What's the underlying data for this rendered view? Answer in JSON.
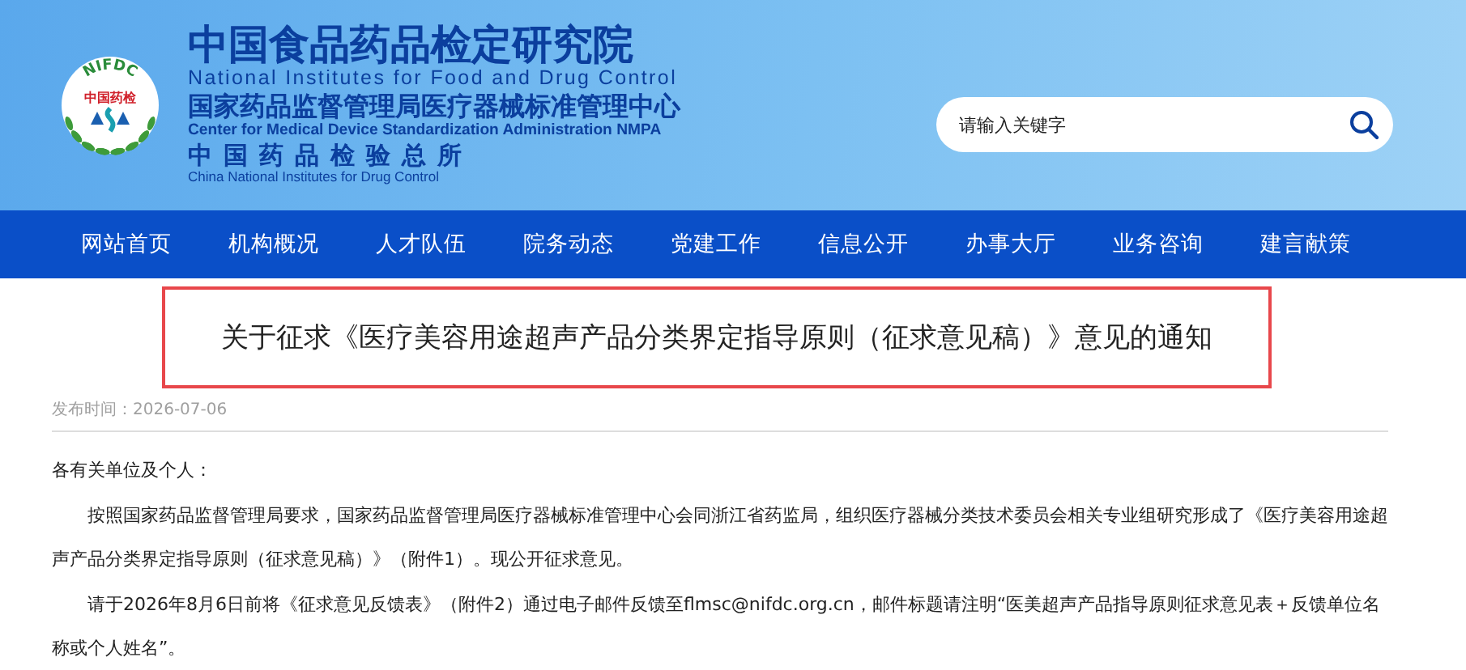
{
  "header": {
    "logo": {
      "arc_text": "NIFDC",
      "badge_text": "中国药检"
    },
    "titles": [
      {
        "kind": "main",
        "zh": "中国食品药品检定研究院",
        "en": "National Institutes for Food and Drug Control"
      },
      {
        "kind": "sub",
        "zh": "国家药品监督管理局医疗器械标准管理中心",
        "en": "Center for Medical Device Standardization Administration NMPA"
      },
      {
        "kind": "spaced",
        "zh": "中国药品检验总所",
        "en": "China National Institutes for Drug Control"
      }
    ],
    "search": {
      "placeholder": "请输入关键字"
    }
  },
  "nav": {
    "items": [
      "网站首页",
      "机构概况",
      "人才队伍",
      "院务动态",
      "党建工作",
      "信息公开",
      "办事大厅",
      "业务咨询",
      "建言献策"
    ]
  },
  "article": {
    "title": "关于征求《医疗美容用途超声产品分类界定指导原则（征求意见稿）》意见的通知",
    "date_label": "发布时间：",
    "date": "2026-07-06",
    "paragraphs": [
      {
        "kind": "salutation",
        "text": "各有关单位及个人："
      },
      {
        "kind": "indented",
        "text": "按照国家药品监督管理局要求，国家药品监督管理局医疗器械标准管理中心会同浙江省药监局，组织医疗器械分类技术委员会相关专业组研究形成了《医疗美容用途超声产品分类界定指导原则（征求意见稿）》（附件1）。现公开征求意见。"
      },
      {
        "kind": "indented",
        "text": "请于2026年8月6日前将《征求意见反馈表》（附件2）通过电子邮件反馈至flmsc@nifdc.org.cn，邮件标题请注明“医美超声产品指导原则征求意见表＋反馈单位名称或个人姓名”。"
      }
    ]
  }
}
